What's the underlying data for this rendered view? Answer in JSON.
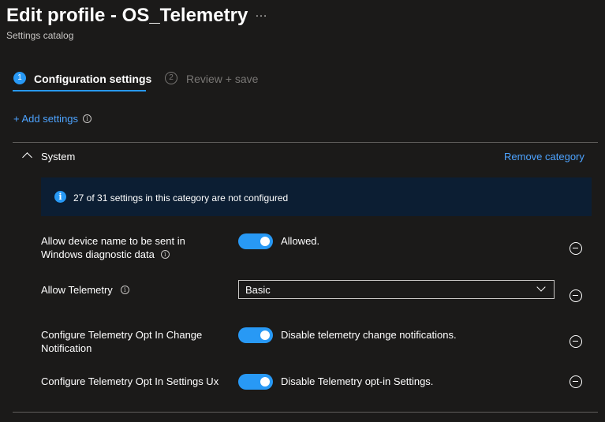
{
  "header": {
    "title": "Edit profile - OS_Telemetry",
    "more_icon": "…",
    "subtitle": "Settings catalog"
  },
  "wizard": {
    "steps": [
      {
        "number": "1",
        "label": "Configuration settings",
        "active": true
      },
      {
        "number": "2",
        "label": "Review + save",
        "active": false
      }
    ]
  },
  "add_settings": {
    "label": "+ Add settings",
    "info_icon": "i"
  },
  "category": {
    "name": "System",
    "remove_label": "Remove category",
    "info_banner": {
      "icon": "i",
      "text": "27 of 31 settings in this category are not configured"
    }
  },
  "settings": [
    {
      "label_line1": "Allow device name to be sent in",
      "label_line2": "Windows diagnostic data",
      "info_icon": "i",
      "control": "toggle",
      "on": true,
      "value_text": "Allowed."
    },
    {
      "label": "Allow Telemetry",
      "info_icon": "i",
      "control": "dropdown",
      "value_text": "Basic"
    },
    {
      "label_line1": "Configure Telemetry Opt In Change",
      "label_line2": "Notification",
      "control": "toggle",
      "on": true,
      "value_text": "Disable telemetry change notifications."
    },
    {
      "label": "Configure Telemetry Opt In Settings Ux",
      "control": "toggle",
      "on": true,
      "value_text": "Disable Telemetry opt-in Settings."
    }
  ],
  "colors": {
    "background": "#1b1a19",
    "accent": "#2899f5",
    "link": "#4da3ff",
    "banner": "#0c1e33",
    "divider": "#605e5c",
    "muted": "#797775"
  }
}
